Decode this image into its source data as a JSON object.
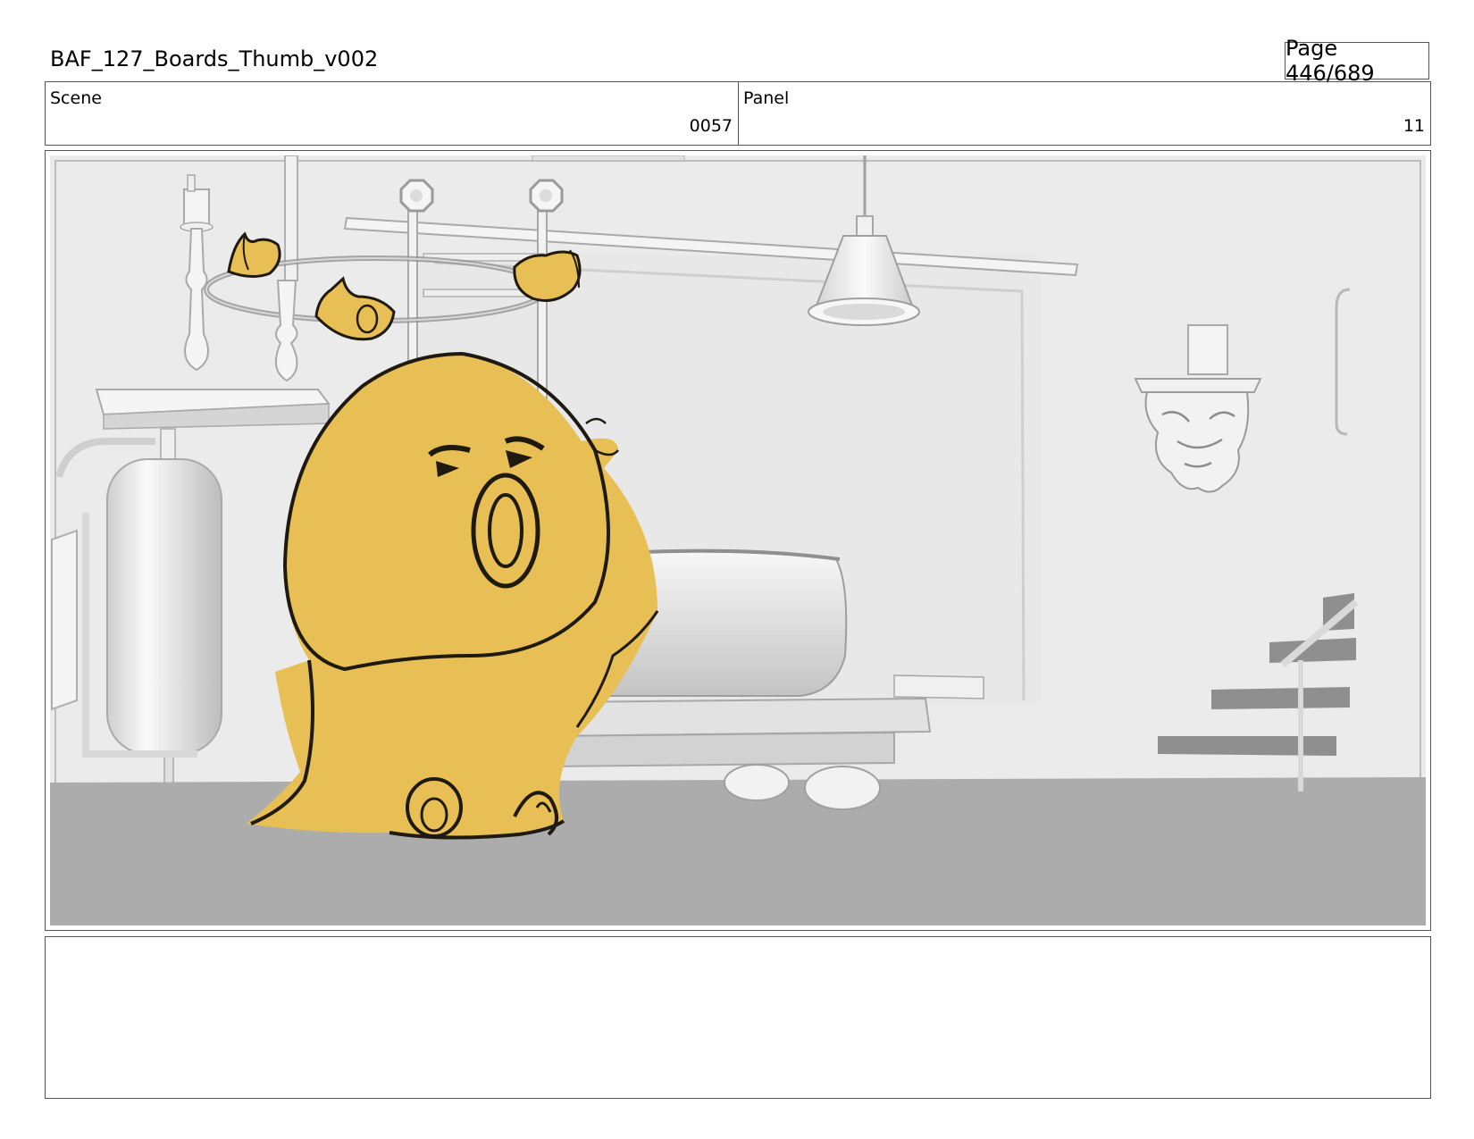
{
  "document": {
    "title": "BAF_127_Boards_Thumb_v002",
    "page_label": "Page 446/689"
  },
  "scene": {
    "label": "Scene",
    "value": "0057"
  },
  "panel": {
    "label": "Panel",
    "value": "11"
  },
  "colors": {
    "character_fill": "#e8bf55",
    "line": "#1e1a10",
    "floor": "#acacac",
    "wall": "#e9e9e9"
  }
}
